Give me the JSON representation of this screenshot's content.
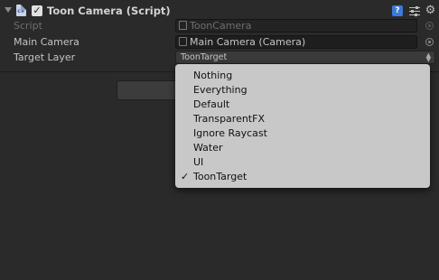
{
  "component": {
    "title": "Toon Camera (Script)",
    "enabled": true,
    "script_icon_label": "c#"
  },
  "fields": {
    "script": {
      "label": "Script",
      "value": "ToonCamera"
    },
    "main_camera": {
      "label": "Main Camera",
      "value": "Main Camera (Camera)"
    },
    "target_layer": {
      "label": "Target Layer",
      "value": "ToonTarget"
    }
  },
  "layer_dropdown": {
    "options": [
      {
        "label": "Nothing",
        "checked": false
      },
      {
        "label": "Everything",
        "checked": false
      },
      {
        "label": "Default",
        "checked": false
      },
      {
        "label": "TransparentFX",
        "checked": false
      },
      {
        "label": "Ignore Raycast",
        "checked": false
      },
      {
        "label": "Water",
        "checked": false
      },
      {
        "label": "UI",
        "checked": false
      },
      {
        "label": "ToonTarget",
        "checked": true
      }
    ]
  },
  "icons": {
    "foldout": "foldout-arrow-icon",
    "help": "help-icon",
    "preset": "preset-icon",
    "settings": "gear-icon",
    "object_picker": "object-picker-icon"
  },
  "colors": {
    "background": "#2a2a2a",
    "dropdown_bg": "#c8c8c8",
    "help_blue": "#3c7ad8"
  }
}
